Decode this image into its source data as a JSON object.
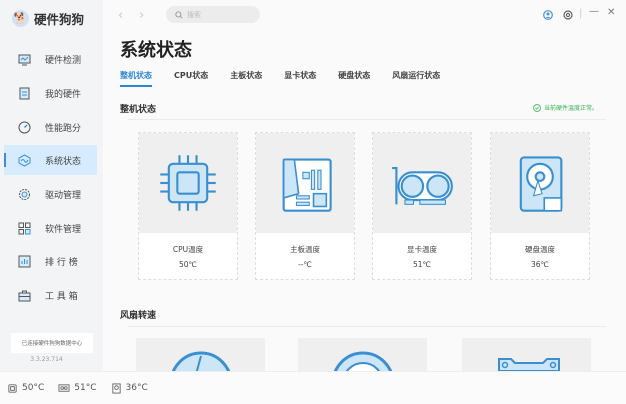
{
  "app": {
    "title": "硬件狗狗"
  },
  "sidebar": {
    "items": [
      {
        "label": "硬件检测",
        "icon": "monitor-icon"
      },
      {
        "label": "我的硬件",
        "icon": "hardware-icon"
      },
      {
        "label": "性能跑分",
        "icon": "gauge-icon"
      },
      {
        "label": "系统状态",
        "icon": "status-icon",
        "active": true
      },
      {
        "label": "驱动管理",
        "icon": "gear-icon"
      },
      {
        "label": "软件管理",
        "icon": "apps-icon"
      },
      {
        "label": "排 行 榜",
        "icon": "chart-icon"
      },
      {
        "label": "工 具 箱",
        "icon": "toolbox-icon"
      }
    ],
    "footer": "已连接硬件狗狗数据中心",
    "version": "3.3.23.714"
  },
  "topbar": {
    "search_placeholder": "搜索"
  },
  "main": {
    "title": "系统状态",
    "tabs": [
      "整机状态",
      "CPU状态",
      "主板状态",
      "显卡状态",
      "硬盘状态",
      "风扇运行状态"
    ],
    "section1": "整机状态",
    "status": "当前硬件温度正常。",
    "cards": [
      {
        "label": "CPU温度",
        "value": "50℃",
        "icon": "cpu-icon"
      },
      {
        "label": "主板温度",
        "value": "--℃",
        "icon": "motherboard-icon"
      },
      {
        "label": "显卡温度",
        "value": "51℃",
        "icon": "gpu-icon"
      },
      {
        "label": "硬盘温度",
        "value": "36℃",
        "icon": "hdd-icon"
      }
    ],
    "section2": "风扇转速"
  },
  "bottom": {
    "cpu": "50°C",
    "gpu": "51°C",
    "hdd": "36°C"
  },
  "colors": {
    "accent": "#2f86d8",
    "ok": "#3cb35a"
  }
}
